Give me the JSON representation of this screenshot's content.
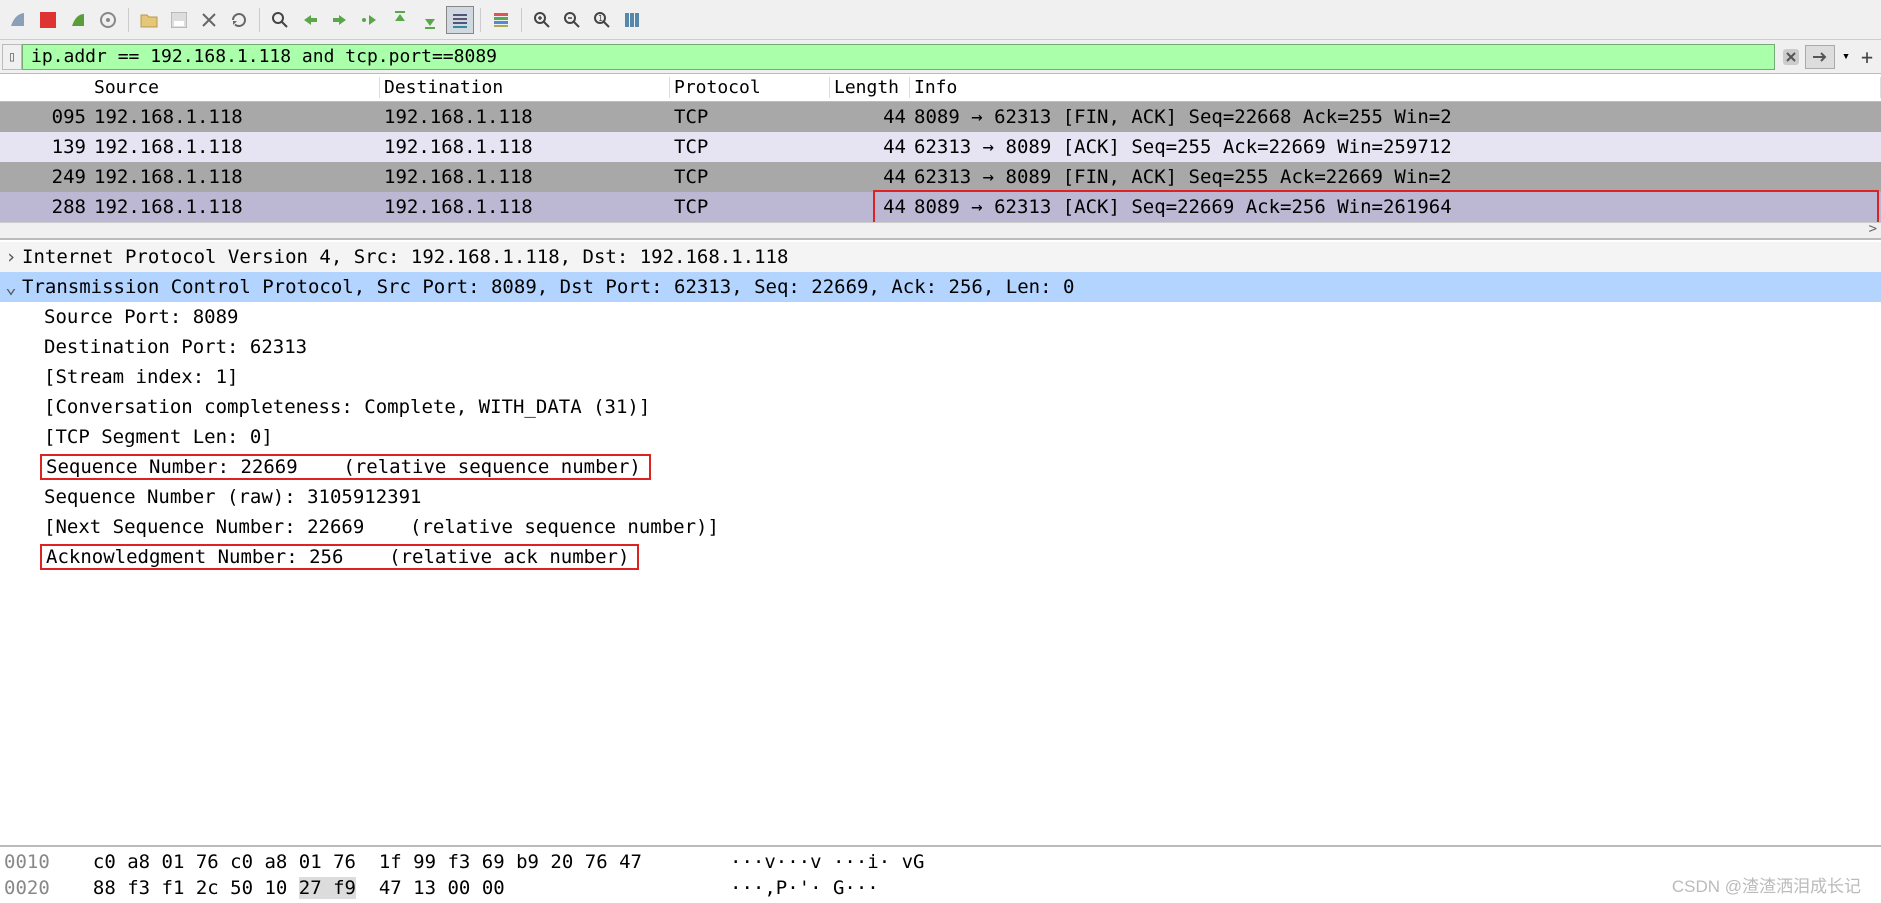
{
  "filter": {
    "value": "ip.addr == 192.168.1.118 and tcp.port==8089"
  },
  "columns": {
    "source": "Source",
    "destination": "Destination",
    "protocol": "Protocol",
    "length": "Length",
    "info": "Info"
  },
  "packets": [
    {
      "no": "095",
      "src": "192.168.1.118",
      "dst": "192.168.1.118",
      "proto": "TCP",
      "len": "44",
      "info": "8089 → 62313 [FIN, ACK] Seq=22668 Ack=255 Win=2",
      "cls": "gray"
    },
    {
      "no": "139",
      "src": "192.168.1.118",
      "dst": "192.168.1.118",
      "proto": "TCP",
      "len": "44",
      "info": "62313 → 8089 [ACK] Seq=255 Ack=22669 Win=259712",
      "cls": "lav"
    },
    {
      "no": "249",
      "src": "192.168.1.118",
      "dst": "192.168.1.118",
      "proto": "TCP",
      "len": "44",
      "info": "62313 → 8089 [FIN, ACK] Seq=255 Ack=22669 Win=2",
      "cls": "gray"
    },
    {
      "no": "288",
      "src": "192.168.1.118",
      "dst": "192.168.1.118",
      "proto": "TCP",
      "len": "44",
      "info": "8089 → 62313 [ACK] Seq=22669 Ack=256 Win=261964",
      "cls": "sel"
    }
  ],
  "detail": {
    "ip_header": "Internet Protocol Version 4, Src: 192.168.1.118, Dst: 192.168.1.118",
    "tcp_header": "Transmission Control Protocol, Src Port: 8089, Dst Port: 62313, Seq: 22669, Ack: 256, Len: 0",
    "fields": [
      "Source Port: 8089",
      "Destination Port: 62313",
      "[Stream index: 1]",
      "[Conversation completeness: Complete, WITH_DATA (31)]",
      "[TCP Segment Len: 0]",
      "Sequence Number: 22669    (relative sequence number)",
      "Sequence Number (raw): 3105912391",
      "[Next Sequence Number: 22669    (relative sequence number)]",
      "Acknowledgment Number: 256    (relative ack number)"
    ],
    "highlighted": [
      5,
      8
    ]
  },
  "hex": {
    "lines": [
      {
        "offset": "0010",
        "bytes": "c0 a8 01 76 c0 a8 01 76  1f 99 f3 69 b9 20 76 47",
        "ascii": "···v···v ···i· vG"
      },
      {
        "offset": "0020",
        "bytes": "88 f3 f1 2c 50 10 27 f9  47 13 00 00",
        "ascii": "···,P·'· G···"
      }
    ]
  },
  "watermark": "CSDN @渣渣洒泪成长记"
}
